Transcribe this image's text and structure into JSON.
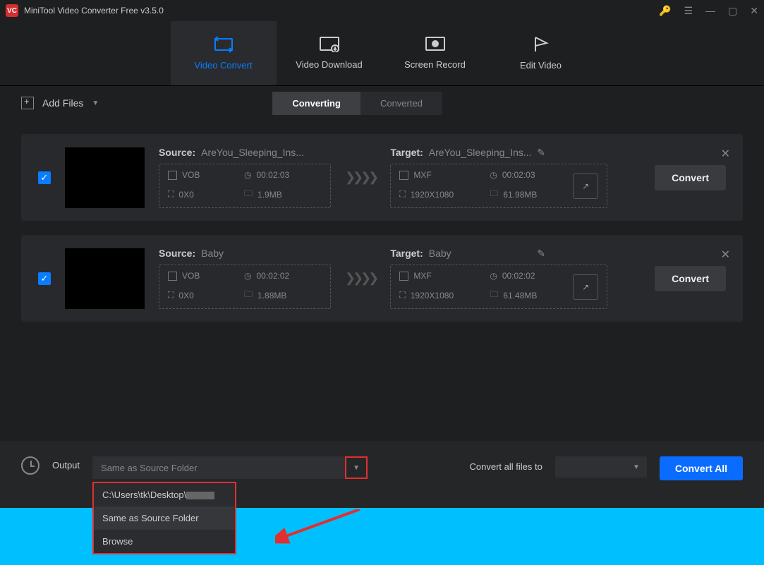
{
  "titlebar": {
    "title": "MiniTool Video Converter Free v3.5.0",
    "logo": "VC"
  },
  "nav": {
    "convert": "Video Convert",
    "download": "Video Download",
    "record": "Screen Record",
    "edit": "Edit Video"
  },
  "toolbar": {
    "add_files": "Add Files",
    "converting": "Converting",
    "converted": "Converted"
  },
  "items": [
    {
      "source_label": "Source:",
      "source_name": "AreYou_Sleeping_Ins...",
      "src_format": "VOB",
      "src_duration": "00:02:03",
      "src_res": "0X0",
      "src_size": "1.9MB",
      "target_label": "Target:",
      "target_name": "AreYou_Sleeping_Ins...",
      "tgt_format": "MXF",
      "tgt_duration": "00:02:03",
      "tgt_res": "1920X1080",
      "tgt_size": "61.98MB",
      "convert": "Convert"
    },
    {
      "source_label": "Source:",
      "source_name": "Baby",
      "src_format": "VOB",
      "src_duration": "00:02:02",
      "src_res": "0X0",
      "src_size": "1.88MB",
      "target_label": "Target:",
      "target_name": "Baby",
      "tgt_format": "MXF",
      "tgt_duration": "00:02:02",
      "tgt_res": "1920X1080",
      "tgt_size": "61.48MB",
      "convert": "Convert"
    }
  ],
  "footer": {
    "output_label": "Output",
    "output_value": "Same as Source Folder",
    "convert_all_label": "Convert all files to",
    "convert_all_btn": "Convert All",
    "menu_path": "C:\\Users\\tk\\Desktop\\",
    "menu_same": "Same as Source Folder",
    "menu_browse": "Browse"
  }
}
